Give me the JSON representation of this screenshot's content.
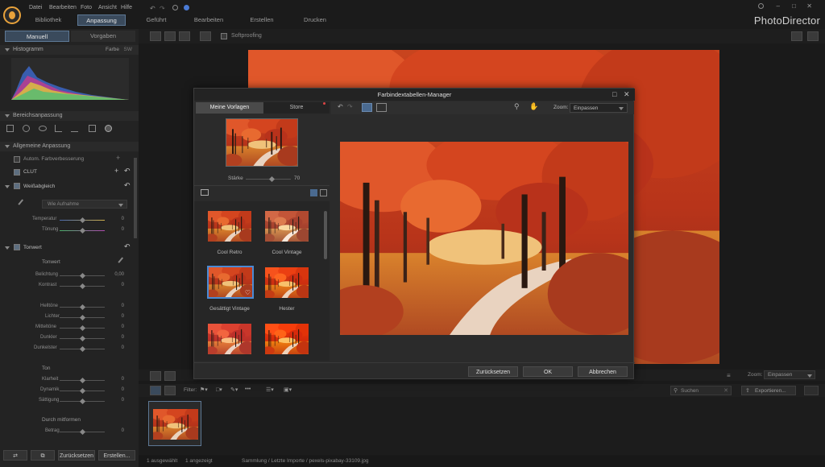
{
  "menu": [
    "Datei",
    "Bearbeiten",
    "Foto",
    "Ansicht",
    "Hilfe"
  ],
  "mode_tabs": [
    "Bibliothek",
    "Anpassung",
    "Geführt",
    "Bearbeiten",
    "Erstellen",
    "Drucken"
  ],
  "mode_active": "Anpassung",
  "brand": "PhotoDirector",
  "left": {
    "tabs": [
      "Manuell",
      "Vorgaben"
    ],
    "histogram": {
      "title": "Histogramm",
      "farbe": "Farbe",
      "sw": "SW"
    },
    "bereichsanpassung": "Bereichsanpassung",
    "allgemeine": "Allgemeine Anpassung",
    "auto_farb": "Autom. Farbverbesserung",
    "clut": "CLUT",
    "weissabgleich": "Weißabgleich",
    "wb_preset": "Wie Aufnahme",
    "temperatur": "Temperatur",
    "toenung": "Tönung",
    "tonwert": "Tonwert",
    "tonwert_sub": "Tonwert",
    "belichtung": "Belichtung",
    "belichtung_val": "0,00",
    "kontrast": "Kontrast",
    "lichter": "Helltöne",
    "hellste": "Lichter",
    "mitteltoene": "Mitteltöne",
    "dunkler": "Dunkler",
    "dunkelster": "Dunkelster",
    "ton": "Ton",
    "klarheit": "Klarheit",
    "dynamik": "Dynamik",
    "saettigung": "Sättigung",
    "unscharf": "Durch mitformen",
    "betrag": "Betrag",
    "zero": "0"
  },
  "toolbar": {
    "softproofing": "Softproofing"
  },
  "dialog": {
    "title": "Farbindextabellen-Manager",
    "tab_meine": "Meine Vorlagen",
    "tab_store": "Store",
    "staerke_label": "Stärke",
    "staerke_val": "70",
    "zoom_label": "Zoom:",
    "zoom_value": "Einpassen",
    "presets": [
      "Cool Retro",
      "Cool Vintage",
      "Gesättigt Vintage",
      "Hester"
    ],
    "btn_reset": "Zurücksetzen",
    "btn_ok": "OK",
    "btn_cancel": "Abbrechen"
  },
  "main_zoom": {
    "label": "Zoom:",
    "value": "Einpassen"
  },
  "filmstrip": {
    "filter": "Filter:",
    "search": "Suchen",
    "export": "Exportieren..."
  },
  "bottom_left": {
    "reset": "Zurücksetzen",
    "create": "Erstellen..."
  },
  "status": {
    "selected": "1 ausgewählt",
    "shown": "1 angezeigt",
    "path": "Sammlung / Letzte Importe / pexels-pixabay-33109.jpg"
  },
  "colors": {
    "accent": "#5d7895",
    "logo": "#e8a23b",
    "panel": "#232323",
    "dialog": "#2b2b2b"
  }
}
